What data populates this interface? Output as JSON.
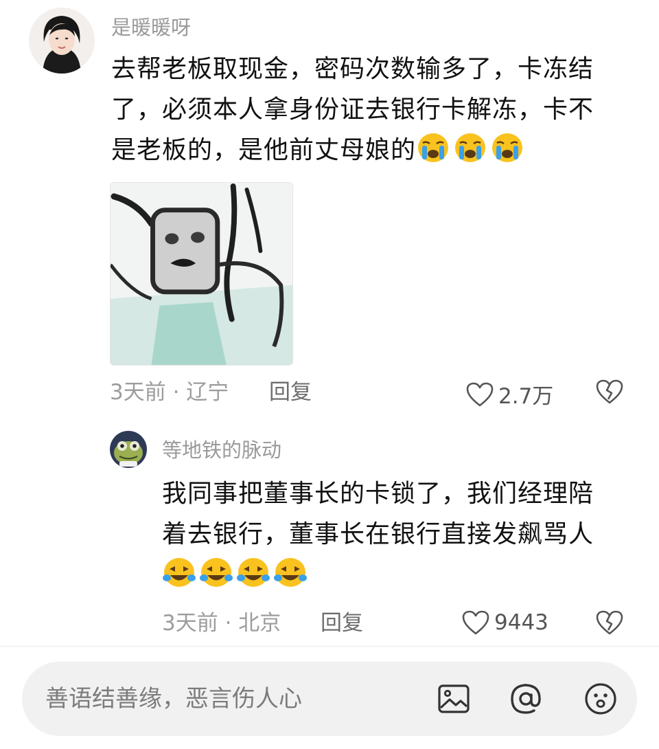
{
  "comment_1": {
    "username": "是暖暖呀",
    "lines": [
      "去帮老板取现金，密码次数输多了，卡冻结",
      "了，必须本人拿身份证去银行卡解冻，卡不",
      "是老板的，是他前丈母娘的"
    ],
    "emojis": [
      "crying-face",
      "crying-face",
      "crying-face"
    ],
    "time_location": "3天前 · 辽宁",
    "reply_label": "回复",
    "like_count": "2.7万"
  },
  "comment_2": {
    "username": "等地铁的脉动",
    "lines": [
      "我同事把董事长的卡锁了，我们经理陪",
      "着去银行，董事长在银行直接发飙骂人"
    ],
    "emojis": [
      "tears-of-joy-face",
      "tears-of-joy-face",
      "tears-of-joy-face",
      "tears-of-joy-face"
    ],
    "time_location": "3天前 · 北京",
    "reply_label": "回复",
    "like_count": "9443"
  },
  "input_bar": {
    "placeholder": "善语结善缘，恶言伤人心",
    "icons": [
      "image-icon",
      "at-icon",
      "emoji-icon"
    ]
  }
}
